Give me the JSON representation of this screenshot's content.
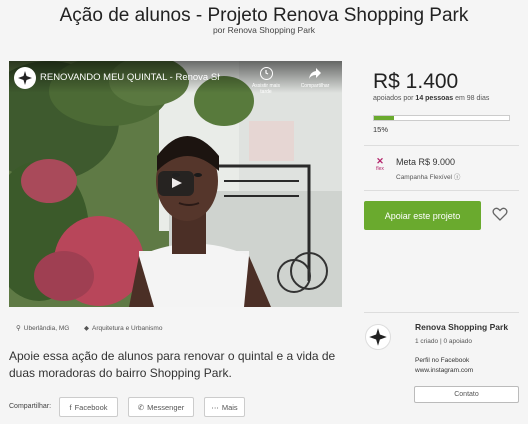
{
  "project": {
    "title": "Ação de alunos - Projeto Renova Shopping Park",
    "byline": "por Renova Shopping Park",
    "location": "Uberlândia, MG",
    "category": "Arquitetura e Urbanismo",
    "description": "Apoie essa ação de alunos para renovar o quintal e a vida de duas moradoras do bairro Shopping Park."
  },
  "video": {
    "title": "RENOVANDO MEU QUINTAL - Renova Sho...",
    "watch_later": "Assistir mais tarde",
    "share": "Compartilhar"
  },
  "funding": {
    "amount": "R$ 1.400",
    "backers_prefix": "apoiados por ",
    "backers_count": "14 pessoas",
    "backers_suffix": " em 98 dias",
    "percent_label": "15%",
    "progress_fraction": 0.15,
    "goal": "Meta R$ 9.000",
    "campaign_type": "Campanha Flexível",
    "flex_badge": "flex",
    "support_button": "Apoiar este projeto"
  },
  "share_bar": {
    "label": "Compartilhar:",
    "facebook": "Facebook",
    "messenger": "Messenger",
    "more": "Mais"
  },
  "creator": {
    "name": "Renova Shopping Park",
    "created": "1 criado",
    "separator": "|",
    "supported": "0 apoiado",
    "facebook_link": "Perfil no Facebook",
    "instagram_link": "www.instagram.com",
    "contact_button": "Contato"
  },
  "colors": {
    "accent_green": "#6aaa2e",
    "flex_magenta": "#b3246b"
  },
  "icons": [
    "location-pin-icon",
    "category-tag-icon",
    "heart-icon",
    "play-icon",
    "clock-icon",
    "share-arrow-icon",
    "facebook-icon",
    "messenger-icon",
    "more-icon",
    "flex-icon",
    "info-icon"
  ]
}
